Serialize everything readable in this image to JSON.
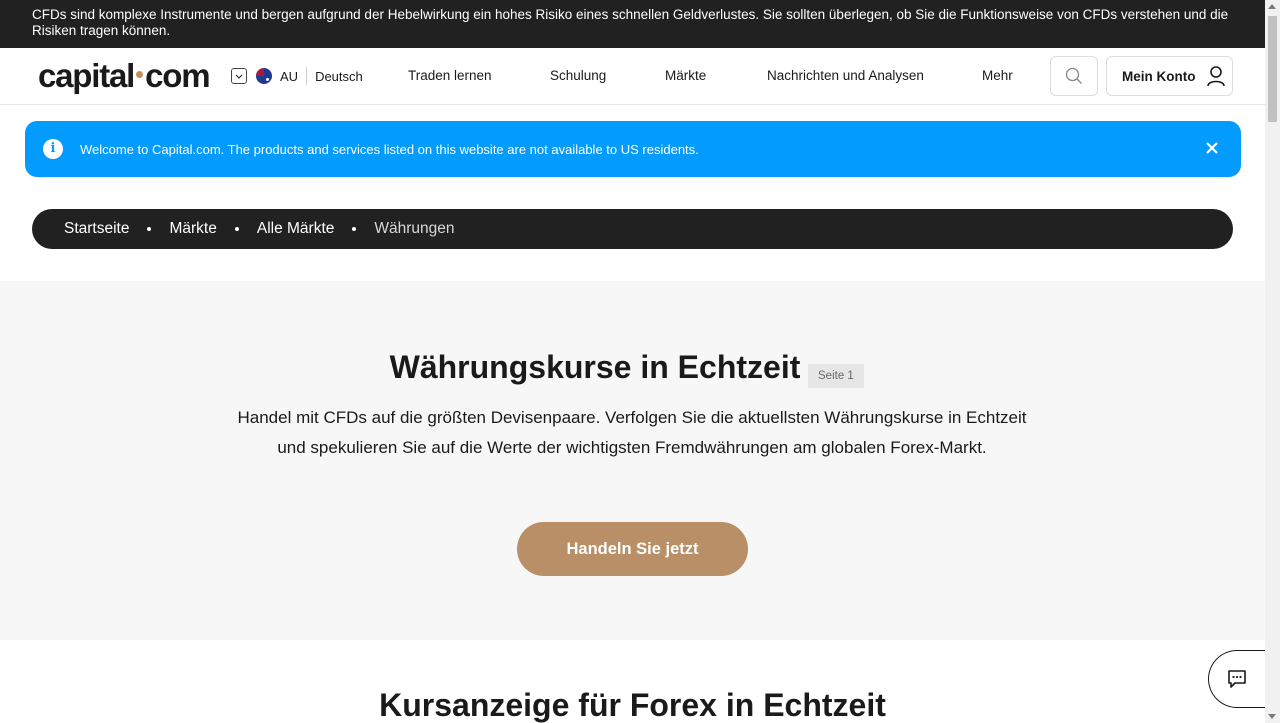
{
  "risk_warning": "CFDs sind komplexe Instrumente und bergen aufgrund der Hebelwirkung ein hohes Risiko eines schnellen Geldverlustes. Sie sollten überlegen, ob Sie die Funktionsweise von CFDs verstehen und die Risiken tragen können.",
  "header": {
    "logo_left": "capital",
    "logo_right": "com",
    "region": "AU",
    "language": "Deutsch",
    "nav": [
      "Traden lernen",
      "Schulung",
      "Märkte",
      "Nachrichten und Analysen",
      "Mehr"
    ],
    "account_label": "Mein Konto"
  },
  "alert": {
    "message": "Welcome to Capital.com. The products and services listed on this website are not available to US residents."
  },
  "breadcrumb": [
    "Startseite",
    "Märkte",
    "Alle Märkte",
    "Währungen"
  ],
  "hero": {
    "title": "Währungskurse in Echtzeit",
    "page_badge": "Seite 1",
    "description": "Handel mit CFDs auf die größten Devisenpaare. Verfolgen Sie die aktuellsten Währungskurse in Echtzeit und spekulieren Sie auf die Werte der wichtigsten Fremdwährungen am globalen Forex-Markt.",
    "cta": "Handeln Sie jetzt"
  },
  "section2_title": "Kursanzeige für Forex in Echtzeit",
  "colors": {
    "accent": "#b88f67",
    "alert_blue": "#049bff",
    "dark": "#212121"
  },
  "icons": [
    "chevron-down-icon",
    "australia-flag-icon",
    "search-icon",
    "user-icon",
    "info-icon",
    "close-icon",
    "chat-icon"
  ]
}
